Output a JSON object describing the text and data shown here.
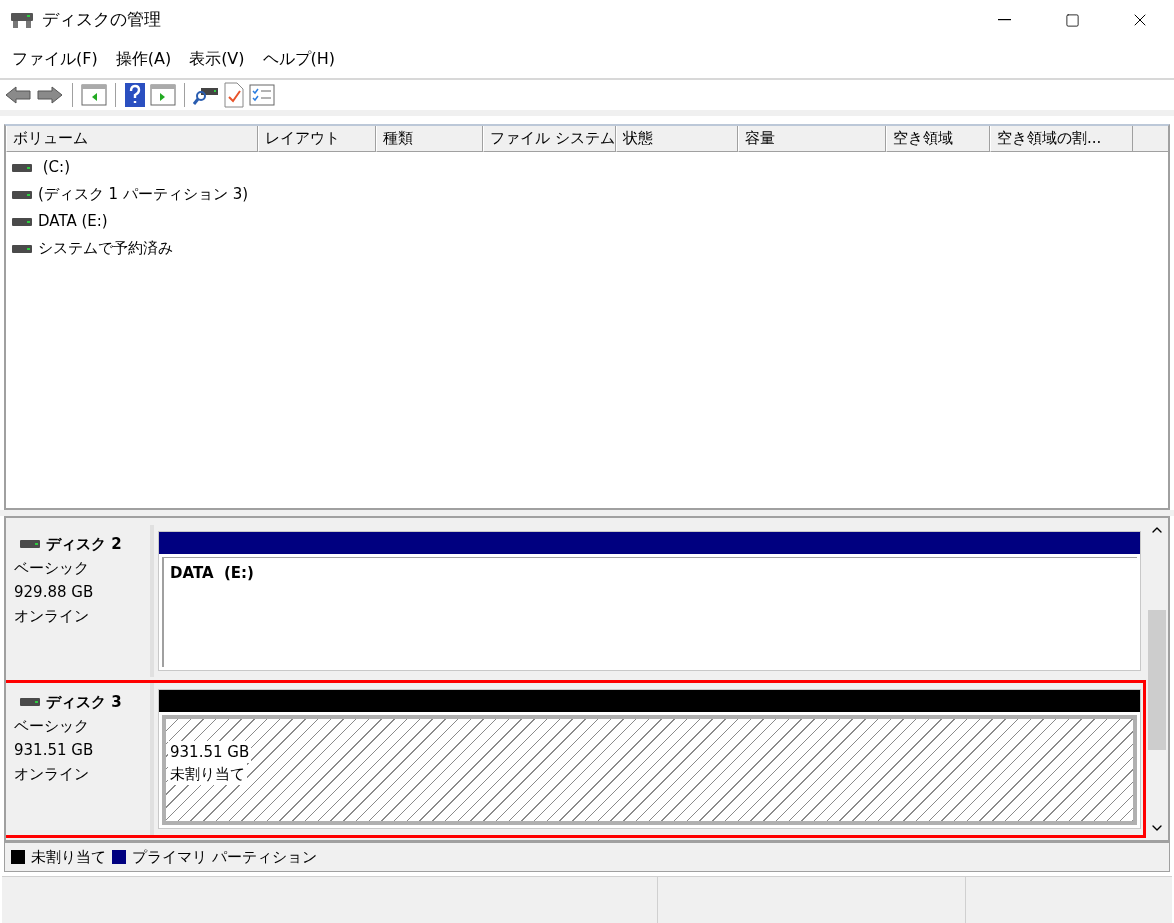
{
  "window": {
    "title": "ディスクの管理"
  },
  "menu": [
    "ファイル(F)",
    "操作(A)",
    "表示(V)",
    "ヘルプ(H)"
  ],
  "volume_table": {
    "columns": [
      "ボリューム",
      "レイアウト",
      "種類",
      "ファイル システム",
      "状態",
      "容量",
      "空き領域",
      "空き領域の割..."
    ],
    "rows": [
      {
        "volume": " (C:)"
      },
      {
        "volume": "(ディスク 1 パーティション 3)"
      },
      {
        "volume": "DATA (E:)"
      },
      {
        "volume": "システムで予約済み"
      }
    ]
  },
  "disks": [
    {
      "name": "ディスク 2",
      "type": "ベーシック",
      "size": "929.88 GB",
      "status": "オンライン",
      "highlighted": false,
      "partitions": [
        {
          "kind": "primary",
          "color": "#000080",
          "label": "DATA  (E:)"
        }
      ]
    },
    {
      "name": "ディスク 3",
      "type": "ベーシック",
      "size": "931.51 GB",
      "status": "オンライン",
      "highlighted": true,
      "partitions": [
        {
          "kind": "unallocated",
          "color": "#000000",
          "lines": [
            "931.51 GB",
            "未割り当て"
          ]
        }
      ]
    }
  ],
  "legend": [
    {
      "color": "#000000",
      "label": "未割り当て"
    },
    {
      "color": "#000080",
      "label": "プライマリ パーティション"
    }
  ]
}
